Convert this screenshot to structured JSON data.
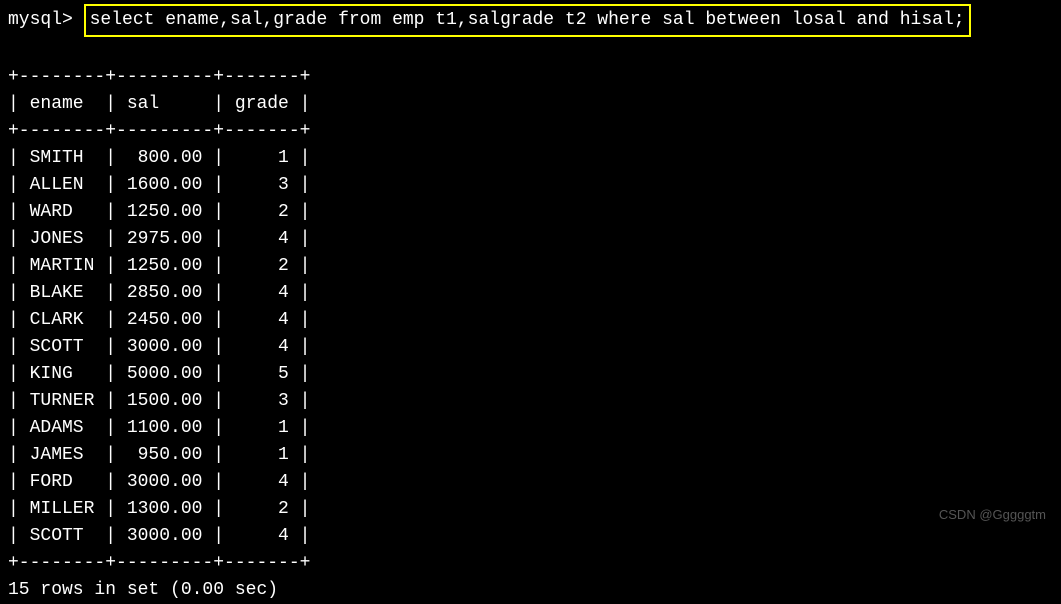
{
  "prompt": "mysql> ",
  "query": "select ename,sal,grade from emp t1,salgrade t2 where sal between losal and hisal;",
  "table": {
    "border_top": "+--------+---------+-------+",
    "header": "| ename  | sal     | grade |",
    "border_mid": "+--------+---------+-------+",
    "rows": [
      "| SMITH  |  800.00 |     1 |",
      "| ALLEN  | 1600.00 |     3 |",
      "| WARD   | 1250.00 |     2 |",
      "| JONES  | 2975.00 |     4 |",
      "| MARTIN | 1250.00 |     2 |",
      "| BLAKE  | 2850.00 |     4 |",
      "| CLARK  | 2450.00 |     4 |",
      "| SCOTT  | 3000.00 |     4 |",
      "| KING   | 5000.00 |     5 |",
      "| TURNER | 1500.00 |     3 |",
      "| ADAMS  | 1100.00 |     1 |",
      "| JAMES  |  950.00 |     1 |",
      "| FORD   | 3000.00 |     4 |",
      "| MILLER | 1300.00 |     2 |",
      "| SCOTT  | 3000.00 |     4 |"
    ],
    "border_bot": "+--------+---------+-------+"
  },
  "status": "15 rows in set (0.00 sec)",
  "watermark": "CSDN @Gggggtm",
  "watermark2": ""
}
